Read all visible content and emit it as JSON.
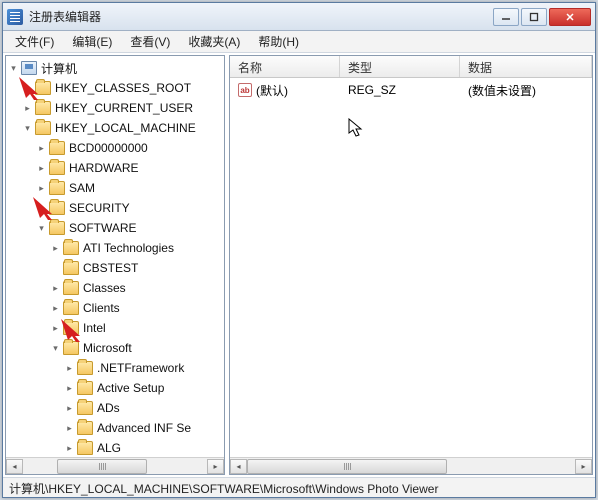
{
  "window": {
    "title": "注册表编辑器"
  },
  "menu": {
    "file": "文件(F)",
    "edit": "编辑(E)",
    "view": "查看(V)",
    "favorites": "收藏夹(A)",
    "help": "帮助(H)"
  },
  "tree": {
    "root": "计算机",
    "hkcr": "HKEY_CLASSES_ROOT",
    "hkcu": "HKEY_CURRENT_USER",
    "hklm": "HKEY_LOCAL_MACHINE",
    "bcd": "BCD00000000",
    "hardware": "HARDWARE",
    "sam": "SAM",
    "security": "SECURITY",
    "software": "SOFTWARE",
    "ati": "ATI Technologies",
    "cbstest": "CBSTEST",
    "classes": "Classes",
    "clients": "Clients",
    "intel": "Intel",
    "microsoft": "Microsoft",
    "netfx": ".NETFramework",
    "activesetup": "Active Setup",
    "ads": "ADs",
    "advinf": "Advanced INF Se",
    "alg": "ALG"
  },
  "list": {
    "col_name": "名称",
    "col_type": "类型",
    "col_data": "数据",
    "rows": [
      {
        "name": "(默认)",
        "type": "REG_SZ",
        "data": "(数值未设置)"
      }
    ]
  },
  "status": "计算机\\HKEY_LOCAL_MACHINE\\SOFTWARE\\Microsoft\\Windows Photo Viewer"
}
